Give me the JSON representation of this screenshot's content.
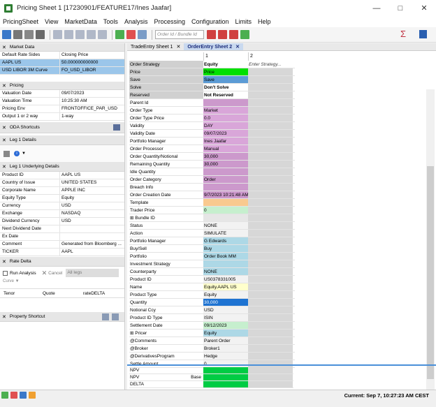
{
  "window": {
    "title": "Pricing Sheet 1 [17230901/FEATURE17/Ines Jaafar]"
  },
  "menu": [
    "PricingSheet",
    "View",
    "MarketData",
    "Tools",
    "Analysis",
    "Processing",
    "Configuration",
    "Limits",
    "Help"
  ],
  "toolbar": {
    "search_placeholder": "Order Id / Bundle Id"
  },
  "left": {
    "market_data": {
      "title": "Market Data",
      "rows": [
        [
          "Default Rate Sides",
          "Closing Price"
        ],
        [
          "AAPL US",
          "50.000000000000"
        ],
        [
          "USD LIBOR 3M Curve",
          "FO_USD_LIBOR"
        ]
      ]
    },
    "pricing": {
      "title": "Pricing",
      "rows": [
        [
          "Valuation Date",
          "09/07/2023"
        ],
        [
          "Valuation Time",
          "10:25:30 AM"
        ],
        [
          "Pricing Env",
          "FRONTOFFICE_PAR_USD"
        ],
        [
          "Output 1 or 2 way",
          "1-way"
        ]
      ]
    },
    "oda": {
      "title": "ODA Shortcuts"
    },
    "leg1": {
      "title": "Leg 1 Details"
    },
    "leg1u": {
      "title": "Leg 1 Underlying Details",
      "rows": [
        [
          "Product ID",
          "AAPL US"
        ],
        [
          "Country of Issue",
          "UNITED STATES"
        ],
        [
          "Corporate Name",
          "APPLE INC"
        ],
        [
          "Equity Type",
          "Equity"
        ],
        [
          "Currency",
          "USD"
        ],
        [
          "Exchange",
          "NASDAQ"
        ],
        [
          "Dividend Currency",
          "USD"
        ],
        [
          "Next Dividend Date",
          ""
        ],
        [
          "Ex Date",
          ""
        ],
        [
          "Comment",
          "Generated from Bloomberg ..."
        ],
        [
          "TICKER",
          "AAPL"
        ]
      ]
    },
    "rate_delta": {
      "title": "Rate Delta",
      "run": "Run Analysis",
      "cancel": "Cancel",
      "legs": "All legs",
      "curve": "Curve",
      "cols": [
        "Tenor",
        "Quote",
        "rateDELTA"
      ]
    },
    "property": {
      "title": "Property Shortcut"
    }
  },
  "tabs": [
    {
      "label": "TradeEntry Sheet  1"
    },
    {
      "label": "OrderEntry Sheet  2"
    }
  ],
  "columns": [
    "1",
    "2"
  ],
  "grid": [
    {
      "l": "Order Strategy",
      "v": "Equity",
      "c2": "Enter Strategy...",
      "lb": "#d0d0d0",
      "vb": "#ffffff",
      "bold": true
    },
    {
      "l": "Price",
      "v": "Price",
      "lb": "#d0d0d0",
      "vb": "#00e000"
    },
    {
      "l": "Save",
      "v": "Save",
      "lb": "#d0d0d0",
      "vb": "#5b9bd5"
    },
    {
      "l": "Solve",
      "v": "Don't Solve",
      "lb": "#d0d0d0",
      "vb": "#ffffff",
      "bold": true
    },
    {
      "l": "Reserved",
      "v": "Not Reserved",
      "lb": "#d0d0d0",
      "vb": "#ffffff",
      "bold": true
    },
    {
      "l": "Parent Id",
      "v": "",
      "vb": "#cc99cc"
    },
    {
      "l": "Order Type",
      "v": "Market",
      "vb": "#d9a6d9"
    },
    {
      "l": "Order Type Price",
      "v": "0.0",
      "vb": "#d9a6d9"
    },
    {
      "l": "Validity",
      "v": "DAY",
      "vb": "#d9a6d9"
    },
    {
      "l": "Validity Date",
      "v": "09/07/2023",
      "vb": "#d9a6d9"
    },
    {
      "l": "Portfolio Manager",
      "v": "Ines Jaafar",
      "vb": "#d9a6d9"
    },
    {
      "l": "Order Processor",
      "v": "Manual",
      "vb": "#d9a6d9"
    },
    {
      "l": "Order Quantity/Notional",
      "v": "30,000",
      "vb": "#cc99cc"
    },
    {
      "l": "Remaining Quantity",
      "v": "30,000",
      "vb": "#cc99cc"
    },
    {
      "l": "Idle Quantity",
      "v": "",
      "vb": "#cc99cc"
    },
    {
      "l": "Order Category",
      "v": "Order",
      "vb": "#cc99cc"
    },
    {
      "l": "Breach Info",
      "v": "",
      "vb": "#cc99cc"
    },
    {
      "l": "Order Creation Date",
      "v": "9/7/2023 10:21:48 AM",
      "vb": "#cc99cc"
    },
    {
      "l": "Template",
      "v": "",
      "vb": "#f9c98f"
    },
    {
      "l": "Trader Price",
      "v": "0",
      "vb": "#c6efce"
    },
    {
      "l": "⊞ Bundle ID",
      "v": "",
      "vb": "#e6e6e6"
    },
    {
      "l": "Status",
      "v": "NONE",
      "vb": "#f2f2f2"
    },
    {
      "l": "Action",
      "v": "SIMULATE",
      "vb": "#f2f2f2"
    },
    {
      "l": "Portfolio Manager",
      "v": "G Edwards",
      "vb": "#add8e6"
    },
    {
      "l": "Buy/Sell",
      "v": "Buy",
      "vb": "#add8e6"
    },
    {
      "l": "Portfolio",
      "v": "Order Book MM",
      "vb": "#add8e6"
    },
    {
      "l": "Investment Strategy",
      "v": "",
      "vb": "#add8e6"
    },
    {
      "l": "Counterparty",
      "v": "NONE",
      "vb": "#add8e6"
    },
    {
      "l": "Product ID",
      "v": "US0378331005",
      "vb": "#f2f2f2"
    },
    {
      "l": "Name",
      "v": "Equity.AAPL US",
      "vb": "#ffffcc"
    },
    {
      "l": "Product Type",
      "v": "Equity",
      "vb": "#f2f2f2"
    },
    {
      "l": "Quantity",
      "v": "30,000",
      "vb": "#1e73d2",
      "vc": "#ffffff"
    },
    {
      "l": "Notional Ccy",
      "v": "USD",
      "vb": "#f2f2f2"
    },
    {
      "l": "Product ID Type",
      "v": "ISIN",
      "vb": "#f2f2f2"
    },
    {
      "l": "Settlement Date",
      "v": "09/12/2023",
      "vb": "#c6efce"
    },
    {
      "l": "⊞ Pricer",
      "v": "Equity",
      "vb": "#add8e6"
    },
    {
      "l": "@Comments",
      "v": "Parent Order",
      "vb": "#f2f2f2"
    },
    {
      "l": "@Broker",
      "v": "Broker1",
      "vb": "#f2f2f2"
    },
    {
      "l": "@DerivativesProgram",
      "v": "Hedge",
      "vb": "#f2f2f2"
    },
    {
      "l": "Settle Amount",
      "v": "0",
      "vb": "#f2f2f2"
    }
  ],
  "npv": [
    {
      "l": "NPV",
      "sub": "",
      "vb": "#00cc44"
    },
    {
      "l": "NPV",
      "sub": "Base",
      "vb": "#00cc44"
    },
    {
      "l": "DELTA",
      "sub": "",
      "vb": "#00cc44"
    }
  ],
  "status": {
    "current": "Current: Sep 7, 10:27:23 AM CEST"
  }
}
